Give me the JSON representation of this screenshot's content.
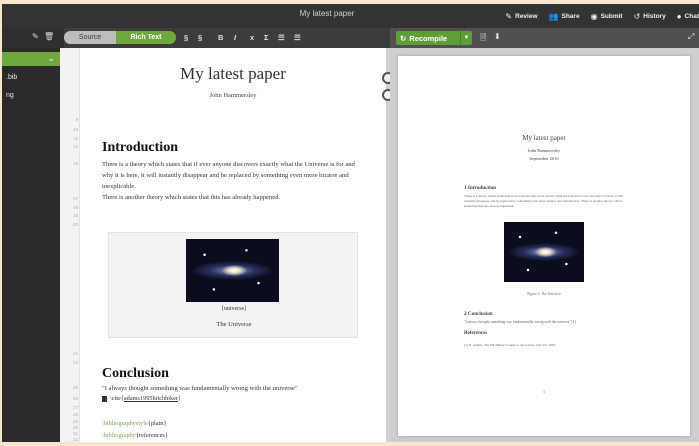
{
  "topbar": {
    "doc_title": "My latest paper",
    "actions": [
      {
        "icon": "review-icon",
        "glyph": "✎",
        "label": "Review"
      },
      {
        "icon": "share-icon",
        "glyph": "👥",
        "label": "Share"
      },
      {
        "icon": "submit-icon",
        "glyph": "◉",
        "label": "Submit"
      },
      {
        "icon": "history-icon",
        "glyph": "↺",
        "label": "History"
      },
      {
        "icon": "chat-icon",
        "glyph": "●",
        "label": "Chat"
      }
    ]
  },
  "toolbar": {
    "mode_source": "Source",
    "mode_rich": "Rich Text",
    "format_buttons": [
      "§",
      "§",
      "B",
      "I",
      "x",
      "Σ",
      "☰",
      "☰"
    ],
    "recompile": "Recompile",
    "recompile_dropdown": "▼",
    "pdf_icons": [
      "🗎",
      "⬇"
    ],
    "expand_icon": "⤢"
  },
  "file_tree": {
    "items": [
      "",
      ".bib",
      "ng"
    ],
    "chevron": "⌄",
    "icons": [
      "✎",
      "🗑"
    ]
  },
  "editor": {
    "line_numbers": [
      "9",
      "10",
      "11",
      "12",
      "16",
      "17",
      "18",
      "19",
      "20",
      "21",
      "22",
      "25",
      "26",
      "27",
      "28",
      "29",
      "30",
      "31",
      "32"
    ],
    "title": "My latest paper",
    "author": "John Hammersley",
    "intro_heading": "Introduction",
    "intro_paragraph": "There is a theory which states that if ever anyone discovers exactly what the Universe is for and why it is here, it will instantly disappear and be replaced by something even more bizarre and inexplicable.\nThere is another theory which states that this has already happened.",
    "figure_filename": "[universe]",
    "figure_caption": "The Universe",
    "conclusion_heading": "Conclusion",
    "conclusion_paragraph": "\"I always thought something was fundamentally wrong with the universe\"",
    "cite_cmd": "\\cite{",
    "cite_key": "adams1995hitchhiker",
    "cite_end": "}",
    "bib_style_cmd": "\\bibliographystyle",
    "bib_style_arg": "{plain}",
    "bib_cmd": "\\bibliography",
    "bib_arg": "{references}"
  },
  "pdf": {
    "title": "My latest paper",
    "author": "John Hammersley",
    "date": "September 2016",
    "section1": "1   Introduction",
    "para1": "There is a theory which states that if ever anyone discovers exactly what the Universe is for and why it is here, it will instantly disappear and be replaced by something even more bizarre and inexplicable. There is another theory which states that this has already happened.",
    "figure_caption": "Figure 1: The Universe",
    "section2": "2   Conclusion",
    "para2": "\"I always thought something was fundamentally wrong with the universe\" [1]",
    "references_heading": "References",
    "reference1": "[1] D. Adams. The Hitchhiker's Guide to the Galaxy. San Val, 1995.",
    "page_number": "1"
  },
  "colors": {
    "accent_green": "#6fa83e",
    "toolbar_dark": "#333333",
    "page_background": "#f7e6cf"
  }
}
